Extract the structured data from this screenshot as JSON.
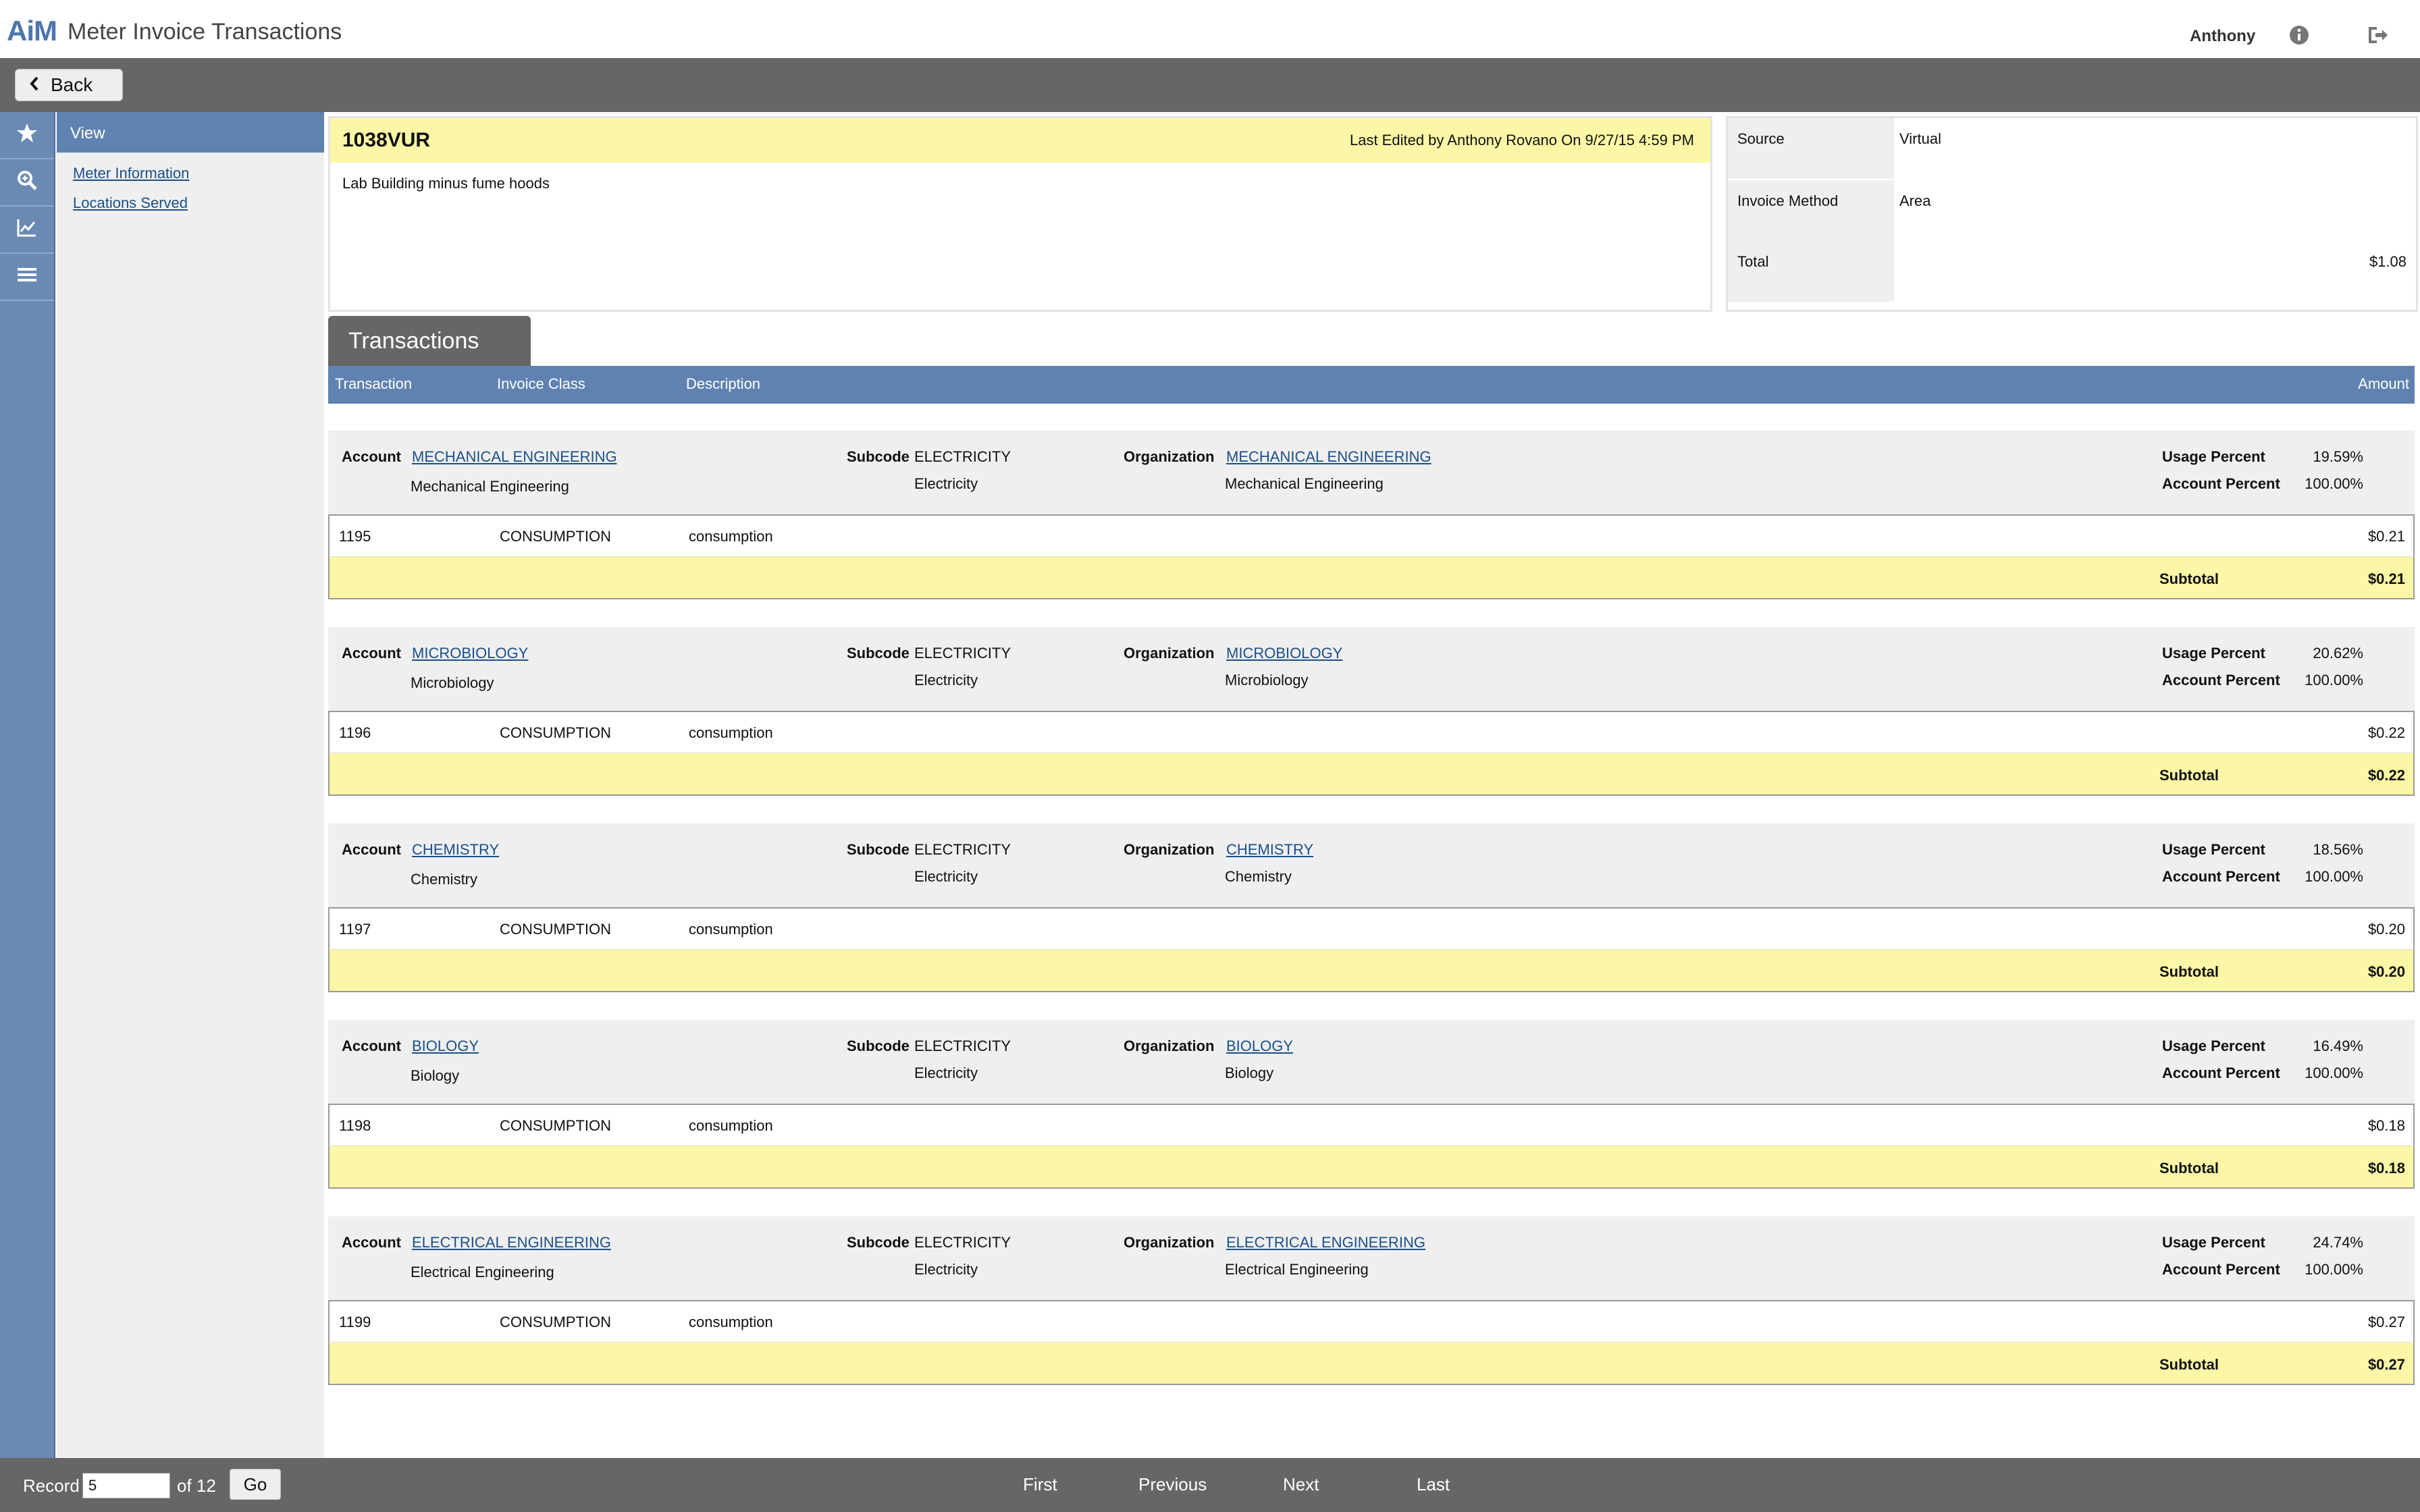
{
  "header": {
    "logo": "AiM",
    "title": "Meter Invoice Transactions",
    "user": "Anthony"
  },
  "toolbar": {
    "back_label": "Back"
  },
  "nav": {
    "heading": "View",
    "items": [
      "Meter Information",
      "Locations Served"
    ]
  },
  "summary": {
    "code": "1038VUR",
    "last_edited": "Last Edited by Anthony Rovano On 9/27/15 4:59 PM",
    "description": "Lab Building minus fume hoods"
  },
  "details": {
    "source_label": "Source",
    "source_value": "Virtual",
    "method_label": "Invoice Method",
    "method_value": "Area",
    "total_label": "Total",
    "total_value": "$1.08"
  },
  "transactions": {
    "tab_label": "Transactions",
    "columns": {
      "transaction": "Transaction",
      "invoice_class": "Invoice Class",
      "description": "Description",
      "amount": "Amount"
    },
    "labels": {
      "account": "Account",
      "subcode": "Subcode",
      "organization": "Organization",
      "usage_percent": "Usage Percent",
      "account_percent": "Account Percent",
      "subtotal": "Subtotal"
    },
    "groups": [
      {
        "account_code": "MECHANICAL ENGINEERING",
        "account_name": "Mechanical Engineering",
        "subcode_code": "ELECTRICITY",
        "subcode_name": "Electricity",
        "org_code": "MECHANICAL ENGINEERING",
        "org_name": "Mechanical Engineering",
        "usage_percent": "19.59%",
        "account_percent": "100.00%",
        "transaction": "1195",
        "invoice_class": "CONSUMPTION",
        "description": "consumption",
        "amount": "$0.21",
        "subtotal": "$0.21"
      },
      {
        "account_code": "MICROBIOLOGY",
        "account_name": "Microbiology",
        "subcode_code": "ELECTRICITY",
        "subcode_name": "Electricity",
        "org_code": "MICROBIOLOGY",
        "org_name": "Microbiology",
        "usage_percent": "20.62%",
        "account_percent": "100.00%",
        "transaction": "1196",
        "invoice_class": "CONSUMPTION",
        "description": "consumption",
        "amount": "$0.22",
        "subtotal": "$0.22"
      },
      {
        "account_code": "CHEMISTRY",
        "account_name": "Chemistry",
        "subcode_code": "ELECTRICITY",
        "subcode_name": "Electricity",
        "org_code": "CHEMISTRY",
        "org_name": "Chemistry",
        "usage_percent": "18.56%",
        "account_percent": "100.00%",
        "transaction": "1197",
        "invoice_class": "CONSUMPTION",
        "description": "consumption",
        "amount": "$0.20",
        "subtotal": "$0.20"
      },
      {
        "account_code": "BIOLOGY",
        "account_name": "Biology",
        "subcode_code": "ELECTRICITY",
        "subcode_name": "Electricity",
        "org_code": "BIOLOGY",
        "org_name": "Biology",
        "usage_percent": "16.49%",
        "account_percent": "100.00%",
        "transaction": "1198",
        "invoice_class": "CONSUMPTION",
        "description": "consumption",
        "amount": "$0.18",
        "subtotal": "$0.18"
      },
      {
        "account_code": "ELECTRICAL ENGINEERING",
        "account_name": "Electrical Engineering",
        "subcode_code": "ELECTRICITY",
        "subcode_name": "Electricity",
        "org_code": "ELECTRICAL ENGINEERING",
        "org_name": "Electrical Engineering",
        "usage_percent": "24.74%",
        "account_percent": "100.00%",
        "transaction": "1199",
        "invoice_class": "CONSUMPTION",
        "description": "consumption",
        "amount": "$0.27",
        "subtotal": "$0.27"
      }
    ]
  },
  "footer": {
    "record_label": "Record",
    "record_value": "5",
    "of_label": "of 12",
    "go_label": "Go",
    "first": "First",
    "previous": "Previous",
    "next": "Next",
    "last": "Last"
  },
  "colors": {
    "accent_blue": "#5f82b0",
    "toolbar_gray": "#666666",
    "highlight_yellow": "#fbf7a6",
    "link": "#1a4f8a"
  },
  "icons": [
    "chevron-left-icon",
    "info-icon",
    "logout-icon",
    "star-icon",
    "search-icon",
    "chart-icon",
    "menu-icon"
  ]
}
